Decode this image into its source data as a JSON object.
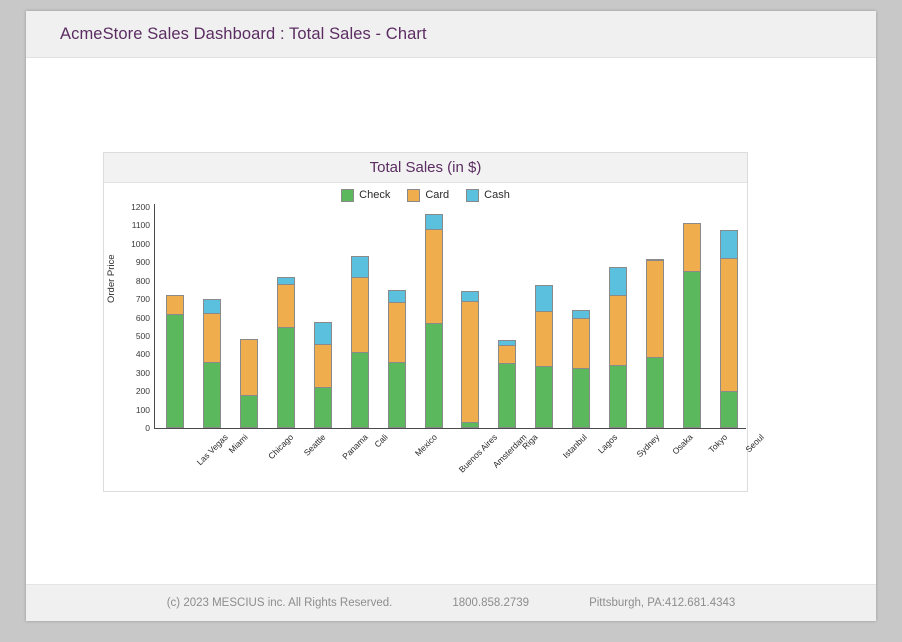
{
  "window": {
    "title": "AcmeStore Sales Dashboard : Total Sales - Chart"
  },
  "footer": {
    "copyright": "(c) 2023 MESCIUS inc. All Rights Reserved.",
    "phone": "1800.858.2739",
    "address": "Pittsburgh, PA:412.681.4343"
  },
  "colors": {
    "title_purple": "#5b2d62",
    "check_green": "#5cb85c",
    "card_orange": "#f0ad4e",
    "cash_blue": "#5bc0de"
  },
  "chart_data": {
    "type": "bar",
    "stacked": true,
    "title": "Total Sales (in $)",
    "xlabel": "",
    "ylabel": "Order Price",
    "ylim": [
      0,
      1200
    ],
    "yticks": [
      0,
      100,
      200,
      300,
      400,
      500,
      600,
      700,
      800,
      900,
      1000,
      1100,
      1200
    ],
    "grid": false,
    "legend_position": "top",
    "categories": [
      "Las Vegas",
      "Miami",
      "Chicago",
      "Seattle",
      "Panama",
      "Cali",
      "Mexico",
      "Buenos Aires",
      "Amsterdam",
      "Riga",
      "Istanbul",
      "Lagos",
      "Sydney",
      "Osaka",
      "Tokyo",
      "Seoul"
    ],
    "series": [
      {
        "name": "Check",
        "color": "#5cb85c",
        "values": [
          620,
          360,
          180,
          550,
          220,
          415,
          360,
          570,
          30,
          355,
          335,
          325,
          340,
          385,
          855,
          200
        ]
      },
      {
        "name": "Card",
        "color": "#f0ad4e",
        "values": [
          100,
          265,
          305,
          230,
          235,
          405,
          325,
          510,
          660,
          95,
          300,
          270,
          385,
          525,
          260,
          725
        ]
      },
      {
        "name": "Cash",
        "color": "#5bc0de",
        "values": [
          0,
          75,
          0,
          40,
          120,
          115,
          65,
          80,
          55,
          30,
          140,
          45,
          150,
          10,
          0,
          150
        ]
      }
    ],
    "totals": [
      720,
      700,
      485,
      820,
      575,
      935,
      750,
      1160,
      745,
      480,
      775,
      640,
      875,
      920,
      1115,
      1075
    ]
  }
}
